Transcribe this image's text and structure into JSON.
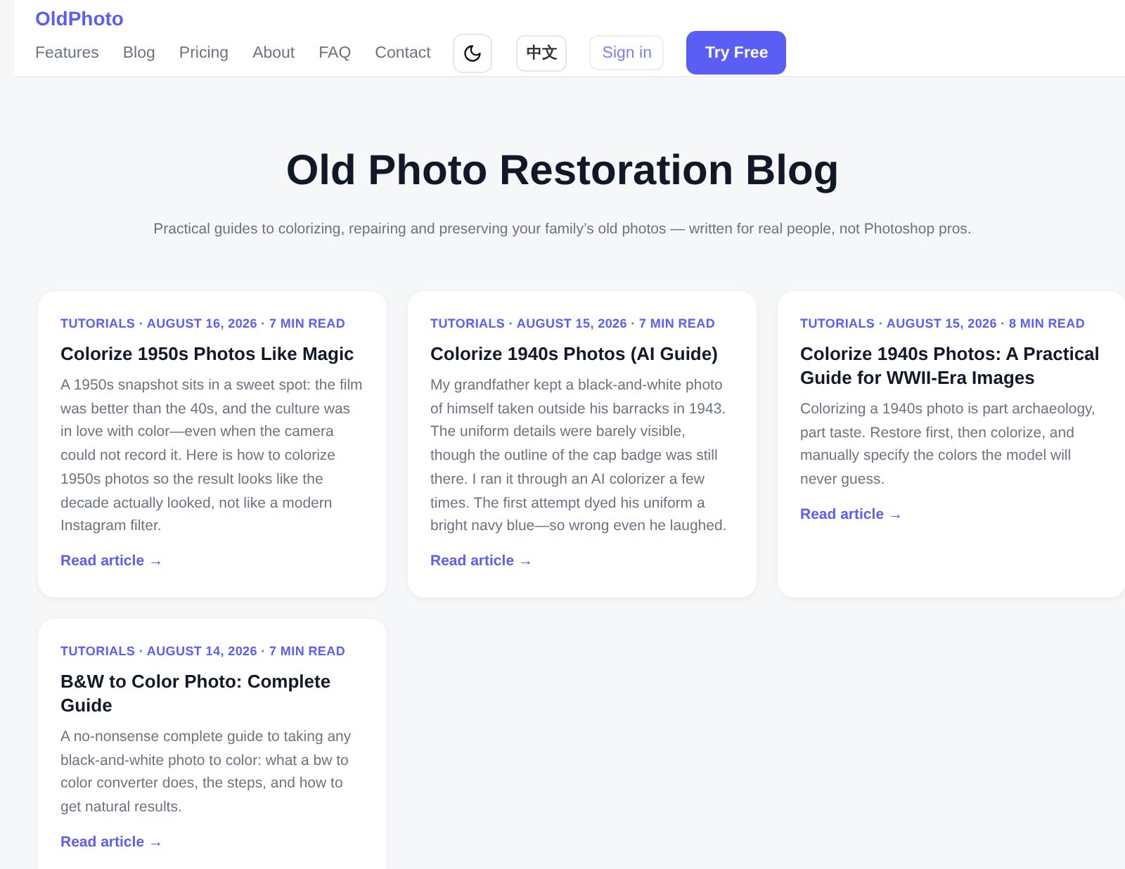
{
  "header": {
    "logo": "OldPhoto",
    "nav": [
      "Features",
      "Blog",
      "Pricing",
      "About",
      "FAQ",
      "Contact"
    ],
    "language": "中文",
    "sign_in": "Sign in",
    "try_free": "Try Free"
  },
  "hero": {
    "title": "Old Photo Restoration Blog",
    "subtitle": "Practical guides to colorizing, repairing and preserving your family’s old photos — written for real people, not Photoshop pros."
  },
  "posts": [
    {
      "meta": "TUTORIALS · AUGUST 16, 2026 · 7 MIN READ",
      "title": "Colorize 1950s Photos Like Magic",
      "excerpt": "A 1950s snapshot sits in a sweet spot: the film was better than the 40s, and the culture was in love with color—even when the camera could not record it. Here is how to colorize 1950s photos so the result looks like the decade actually looked, not like a modern Instagram filter.",
      "link": "Read article →"
    },
    {
      "meta": "TUTORIALS · AUGUST 15, 2026 · 7 MIN READ",
      "title": "Colorize 1940s Photos (AI Guide)",
      "excerpt": "My grandfather kept a black-and-white photo of himself taken outside his barracks in 1943. The uniform details were barely visible, though the outline of the cap badge was still there. I ran it through an AI colorizer a few times. The first attempt dyed his uniform a bright navy blue—so wrong even he laughed.",
      "link": "Read article →"
    },
    {
      "meta": "TUTORIALS · AUGUST 15, 2026 · 8 MIN READ",
      "title": "Colorize 1940s Photos: A Practical Guide for WWII-Era Images",
      "excerpt": "Colorizing a 1940s photo is part archaeology, part taste. Restore first, then colorize, and manually specify the colors the model will never guess.",
      "link": "Read article →"
    },
    {
      "meta": "TUTORIALS · AUGUST 14, 2026 · 7 MIN READ",
      "title": "B&W to Color Photo: Complete Guide",
      "excerpt": "A no-nonsense complete guide to taking any black-and-white photo to color: what a bw to color converter does, the steps, and how to get natural results.",
      "link": "Read article →"
    }
  ]
}
